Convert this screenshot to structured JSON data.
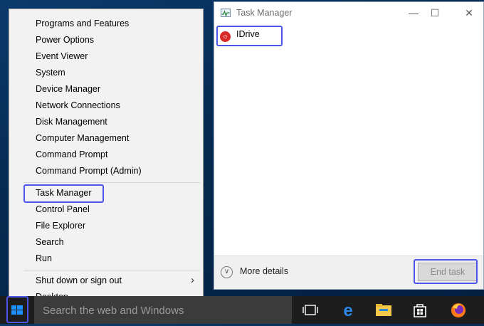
{
  "context_menu": {
    "items": [
      {
        "label": "Programs and Features"
      },
      {
        "label": "Power Options"
      },
      {
        "label": "Event Viewer"
      },
      {
        "label": "System"
      },
      {
        "label": "Device Manager"
      },
      {
        "label": "Network Connections"
      },
      {
        "label": "Disk Management"
      },
      {
        "label": "Computer Management"
      },
      {
        "label": "Command Prompt"
      },
      {
        "label": "Command Prompt (Admin)"
      },
      {
        "label": "Task Manager"
      },
      {
        "label": "Control Panel"
      },
      {
        "label": "File Explorer"
      },
      {
        "label": "Search"
      },
      {
        "label": "Run"
      },
      {
        "label": "Shut down or sign out"
      },
      {
        "label": "Desktop"
      }
    ]
  },
  "task_manager": {
    "title": "Task Manager",
    "processes": [
      {
        "name": "IDrive"
      }
    ],
    "more_details": "More details",
    "end_task": "End task"
  },
  "taskbar": {
    "search_placeholder": "Search the web and Windows",
    "icons": [
      "windows-start-icon",
      "task-view-icon",
      "edge-icon",
      "file-explorer-icon",
      "store-icon",
      "firefox-icon"
    ]
  },
  "colors": {
    "highlight": "#4b56e8",
    "taskbar": "#1d1d1d",
    "start_icon": "#1e90ff"
  }
}
